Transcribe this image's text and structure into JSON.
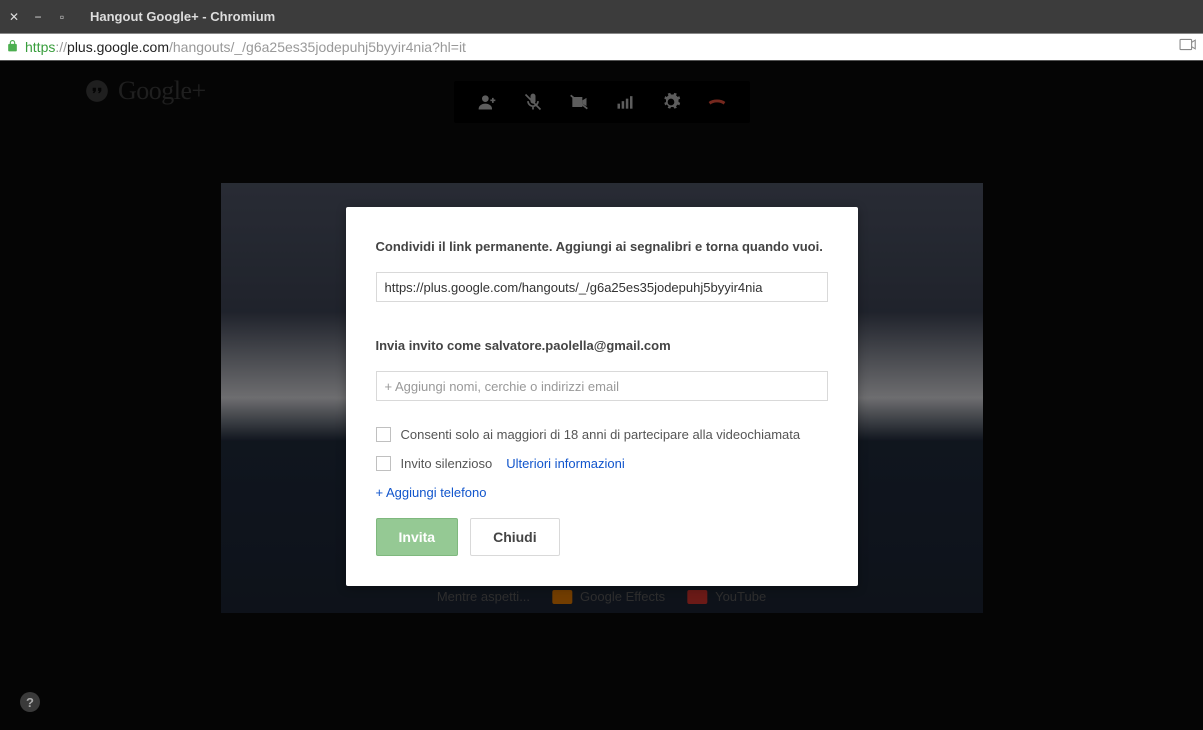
{
  "window": {
    "title": "Hangout Google+ - Chromium"
  },
  "url": {
    "proto": "https",
    "separator": "://",
    "host": "plus.google.com",
    "path": "/hangouts/_/g6a25es35jodepuhj5byyir4nia?hl=it"
  },
  "logo": {
    "text": "Google+"
  },
  "modal": {
    "share_prompt": "Condividi il link permanente. Aggiungi ai segnalibri e torna quando vuoi.",
    "share_url": "https://plus.google.com/hangouts/_/g6a25es35jodepuhj5byyir4nia",
    "invite_as": "Invia invito come salvatore.paolella@gmail.com",
    "invite_placeholder": "+ Aggiungi nomi, cerchie o indirizzi email",
    "age_restrict": "Consenti solo ai maggiori di 18 anni di partecipare alla videochiamata",
    "silent_invite": "Invito silenzioso",
    "more_info": "Ulteriori informazioni",
    "add_phone": "+ Aggiungi telefono",
    "invite_btn": "Invita",
    "close_btn": "Chiudi"
  },
  "waiting": {
    "prompt": "Mentre aspetti...",
    "effects": "Google Effects",
    "youtube": "YouTube"
  },
  "help": "?"
}
